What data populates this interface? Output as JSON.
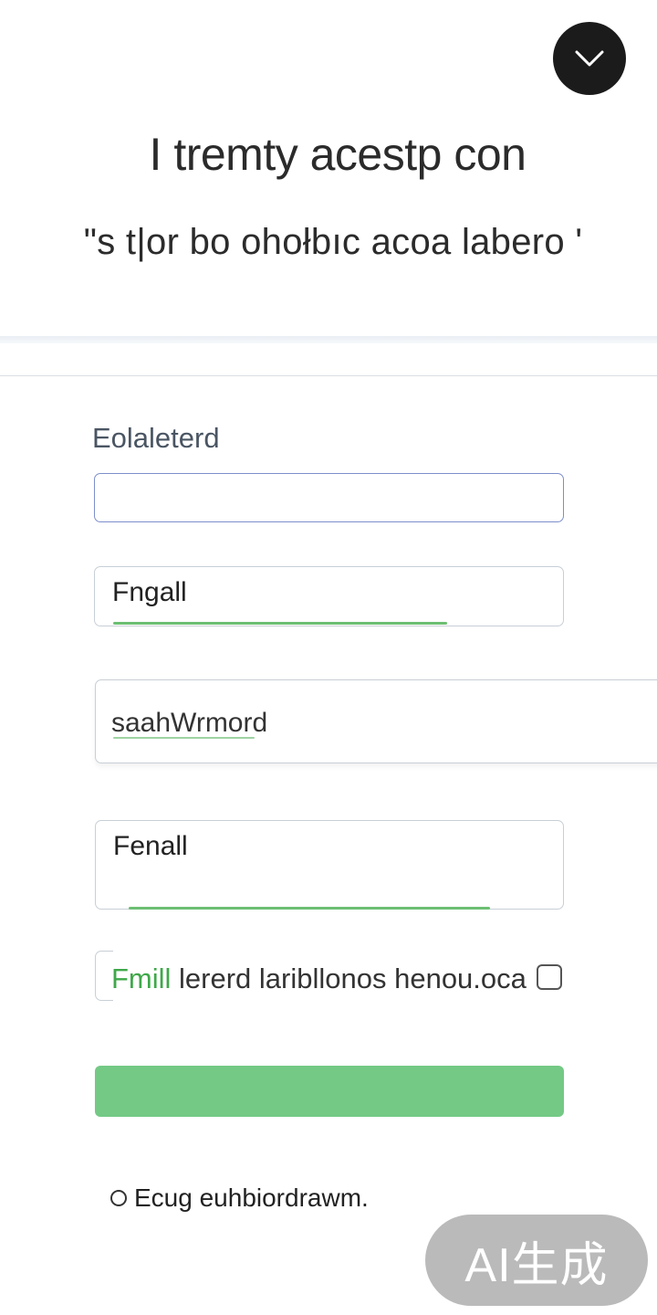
{
  "header": {
    "close_icon": "chevron-down-icon",
    "title": "I tremty acestp con",
    "subtitle": "\"s t|or bo ohołbıc acoa labero '"
  },
  "form": {
    "field_label": "Eolaleterd",
    "input_1_value": "",
    "input_2_value": "Fngall",
    "input_3_value": "saahWrmord",
    "input_4_value": "Fenall",
    "consent": {
      "accent_text": "Fmill",
      "text": " lererd laribllonos henou.oca",
      "checked": false
    },
    "submit_label": "",
    "bottom_link": "Ecug euhbiordrawm."
  },
  "watermark": "AI生成",
  "colors": {
    "accent_green": "#74c985",
    "underline_green": "#6cbf72",
    "focus_border": "#7d8fcb",
    "close_button_bg": "#1b1b1b"
  }
}
